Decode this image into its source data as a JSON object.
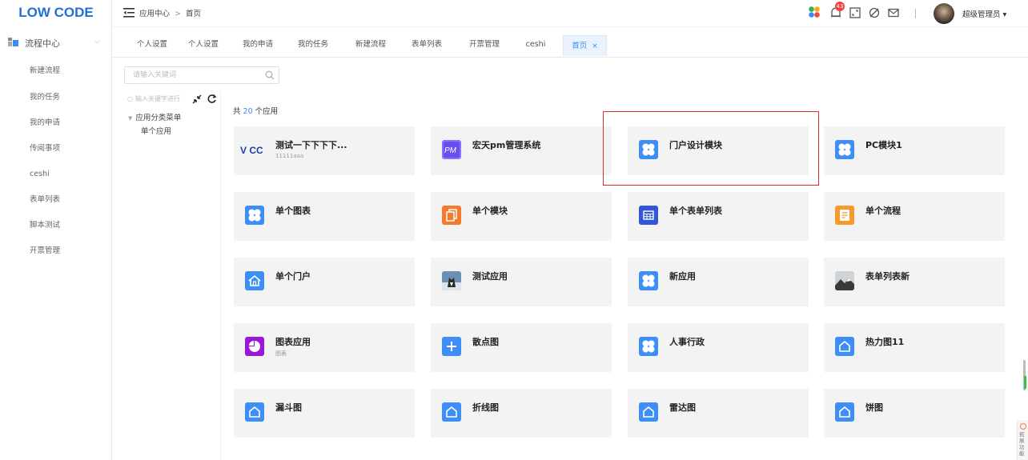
{
  "app": {
    "logo": "LOW CODE"
  },
  "sidebar": {
    "section_label": "流程中心",
    "items": [
      {
        "label": "新建流程"
      },
      {
        "label": "我的任务"
      },
      {
        "label": "我的申请"
      },
      {
        "label": "传阅事项"
      },
      {
        "label": "ceshi"
      },
      {
        "label": "表单列表"
      },
      {
        "label": "脚本测试"
      },
      {
        "label": "开票管理"
      }
    ]
  },
  "header": {
    "breadcrumb": [
      "应用中心",
      "首页"
    ],
    "breadcrumb_sep": ">",
    "notification_count": "43",
    "user_name": "超级管理员",
    "user_caret": "▾",
    "icon_names": [
      "apps-icon",
      "bell-icon",
      "fullscreen-icon",
      "theme-icon",
      "mail-icon",
      "divider",
      "avatar"
    ]
  },
  "tabs": [
    {
      "label": "个人设置"
    },
    {
      "label": "个人设置"
    },
    {
      "label": "我的申请"
    },
    {
      "label": "我的任务"
    },
    {
      "label": "新建流程"
    },
    {
      "label": "表单列表"
    },
    {
      "label": "开票管理"
    },
    {
      "label": "ceshi"
    },
    {
      "label": "首页",
      "active": true,
      "close": "×"
    }
  ],
  "search": {
    "placeholder": "请输入关键词"
  },
  "tree": {
    "search_placeholder": "输入关键字进行",
    "root": "应用分类菜单",
    "child": "单个应用"
  },
  "summary": {
    "prefix": "共",
    "count": "20",
    "suffix": "个应用"
  },
  "apps": [
    {
      "title": "测试一下下下下...",
      "subtitle": "11111aaa",
      "icon": "lowcode-text-icon",
      "icon_text": "V CC",
      "color": "#1a3da8"
    },
    {
      "title": "宏天pm管理系统",
      "subtitle": "",
      "icon": "pm-logo-icon",
      "icon_text": "PM",
      "color": "#6a4df0"
    },
    {
      "title": "门户设计模块",
      "subtitle": "",
      "icon": "four-petal-icon",
      "color": "#3d8ef7"
    },
    {
      "title": "PC模块1",
      "subtitle": "",
      "icon": "four-petal-icon",
      "color": "#3d8ef7"
    },
    {
      "title": "单个图表",
      "subtitle": "",
      "icon": "four-petal-icon",
      "color": "#3d8ef7"
    },
    {
      "title": "单个模块",
      "subtitle": "",
      "icon": "copy-doc-icon",
      "color": "#f47a30"
    },
    {
      "title": "单个表单列表",
      "subtitle": "",
      "icon": "table-grid-icon",
      "color": "#3356d8"
    },
    {
      "title": "单个流程",
      "subtitle": "",
      "icon": "form-doc-icon",
      "color": "#f79a2a"
    },
    {
      "title": "单个门户",
      "subtitle": "",
      "icon": "home-icon",
      "color": "#3d8ef7"
    },
    {
      "title": "测试应用",
      "subtitle": "",
      "icon": "dog-photo-icon",
      "color": "#6b8fb5"
    },
    {
      "title": "新应用",
      "subtitle": "",
      "icon": "four-petal-icon",
      "color": "#3d8ef7"
    },
    {
      "title": "表单列表新",
      "subtitle": "",
      "icon": "landscape-photo-icon",
      "color": "#8a8a8a"
    },
    {
      "title": "图表应用",
      "subtitle": "图表",
      "icon": "pie-chart-icon",
      "color": "#9b16d6"
    },
    {
      "title": "散点图",
      "subtitle": "",
      "icon": "plus-icon",
      "color": "#3d8ef7"
    },
    {
      "title": "人事行政",
      "subtitle": "",
      "icon": "four-petal-icon",
      "color": "#3d8ef7"
    },
    {
      "title": "热力图11",
      "subtitle": "",
      "icon": "house-outline-icon",
      "color": "#3d8ef7"
    },
    {
      "title": "漏斗图",
      "subtitle": "",
      "icon": "house-outline-icon",
      "color": "#3d8ef7"
    },
    {
      "title": "折线图",
      "subtitle": "",
      "icon": "house-outline-icon",
      "color": "#3d8ef7"
    },
    {
      "title": "雷达图",
      "subtitle": "",
      "icon": "house-outline-icon",
      "color": "#3d8ef7"
    },
    {
      "title": "饼图",
      "subtitle": "",
      "icon": "house-outline-icon",
      "color": "#3d8ef7"
    }
  ],
  "right_widget": {
    "label": "拓展功能"
  },
  "colors": {
    "brand": "#1e6fd9",
    "active_tab": "#3b8ef0",
    "highlight_box": "#d9312f"
  }
}
